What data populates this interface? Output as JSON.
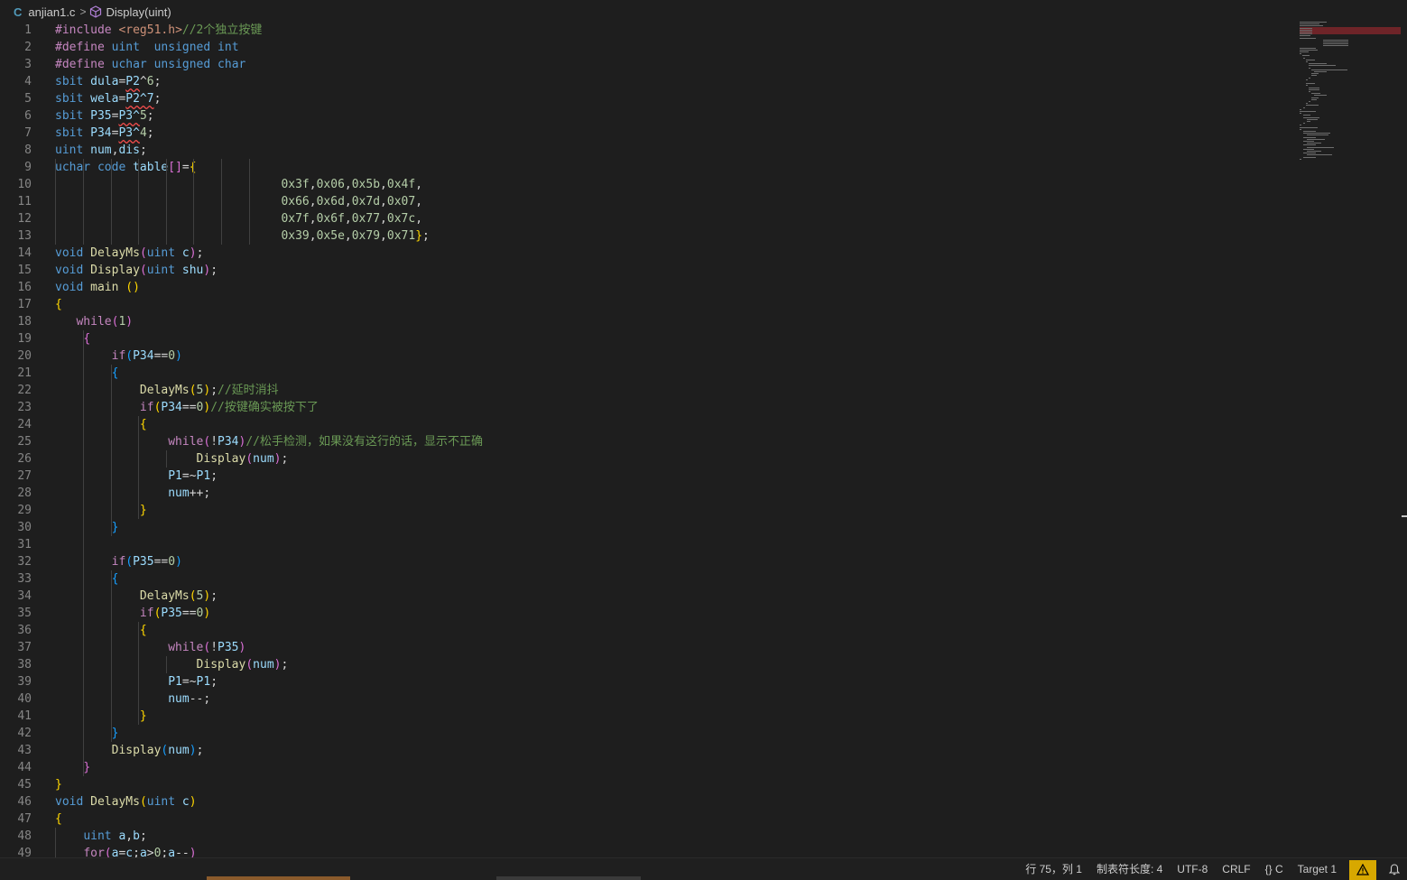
{
  "breadcrumb": {
    "file_icon_label": "C",
    "file": "anjian1.c",
    "separator": ">",
    "symbol": "Display(uint)",
    "symbol_icon": "cube-icon"
  },
  "code_lines": [
    {
      "n": "1",
      "html": "<span class=\"pp\">#include</span> <span class=\"str\">&lt;reg51.h&gt;</span><span class=\"cm\">//2个独立按键</span>"
    },
    {
      "n": "2",
      "html": "<span class=\"pp\">#define</span> <span class=\"kw\">uint</span>  <span class=\"kw\">unsigned</span> <span class=\"kw\">int</span>"
    },
    {
      "n": "3",
      "html": "<span class=\"pp\">#define</span> <span class=\"kw\">uchar</span> <span class=\"kw\">unsigned</span> <span class=\"kw\">char</span>"
    },
    {
      "n": "4",
      "html": "<span class=\"kw\">sbit</span> <span class=\"var\">dula</span>=<span class=\"var sq\">P2</span><span class=\"op\">^</span><span class=\"num\">6</span>;"
    },
    {
      "n": "5",
      "html": "<span class=\"kw\">sbit</span> <span class=\"var\">wela</span>=<span class=\"var sq\">P2^7</span>;"
    },
    {
      "n": "6",
      "html": "<span class=\"kw\">sbit</span> <span class=\"var\">P35</span>=<span class=\"var sq\">P3^</span><span class=\"num\">5</span>;"
    },
    {
      "n": "7",
      "html": "<span class=\"kw\">sbit</span> <span class=\"var\">P34</span>=<span class=\"var sq\">P3^</span><span class=\"num\">4</span>;"
    },
    {
      "n": "8",
      "html": "<span class=\"kw\">uint</span> <span class=\"var\">num</span>,<span class=\"var\">dis</span>;"
    },
    {
      "n": "9",
      "html": "<span class=\"kw\">uchar</span> <span class=\"kw\">code</span> <span class=\"var\">table</span><span class=\"b2\">[]</span>=<span class=\"b1\">{</span>"
    },
    {
      "n": "10",
      "html": "                                <span class=\"num\">0x3f</span>,<span class=\"num\">0x06</span>,<span class=\"num\">0x5b</span>,<span class=\"num\">0x4f</span>,"
    },
    {
      "n": "11",
      "html": "                                <span class=\"num\">0x66</span>,<span class=\"num\">0x6d</span>,<span class=\"num\">0x7d</span>,<span class=\"num\">0x07</span>,"
    },
    {
      "n": "12",
      "html": "                                <span class=\"num\">0x7f</span>,<span class=\"num\">0x6f</span>,<span class=\"num\">0x77</span>,<span class=\"num\">0x7c</span>,"
    },
    {
      "n": "13",
      "html": "                                <span class=\"num\">0x39</span>,<span class=\"num\">0x5e</span>,<span class=\"num\">0x79</span>,<span class=\"num\">0x71</span><span class=\"b1\">}</span>;"
    },
    {
      "n": "14",
      "html": "<span class=\"kw\">void</span> <span class=\"fn\">DelayMs</span><span class=\"b2\">(</span><span class=\"kw\">uint</span> <span class=\"var\">c</span><span class=\"b2\">)</span>;"
    },
    {
      "n": "15",
      "html": "<span class=\"kw\">void</span> <span class=\"fn\">Display</span><span class=\"b2\">(</span><span class=\"kw\">uint</span> <span class=\"var\">shu</span><span class=\"b2\">)</span>;"
    },
    {
      "n": "16",
      "html": "<span class=\"kw\">void</span> <span class=\"fn\">main</span> <span class=\"b1\">()</span>"
    },
    {
      "n": "17",
      "html": "<span class=\"b1\">{</span>"
    },
    {
      "n": "18",
      "html": "   <span class=\"ctrl\">while</span><span class=\"b2\">(</span><span class=\"num\">1</span><span class=\"b2\">)</span>"
    },
    {
      "n": "19",
      "html": "    <span class=\"b2\">{</span>"
    },
    {
      "n": "20",
      "html": "        <span class=\"ctrl\">if</span><span class=\"b3\">(</span><span class=\"var\">P34</span>==<span class=\"num\">0</span><span class=\"b3\">)</span>"
    },
    {
      "n": "21",
      "html": "        <span class=\"b3\">{</span>"
    },
    {
      "n": "22",
      "html": "            <span class=\"fn\">DelayMs</span><span class=\"b1\">(</span><span class=\"num\">5</span><span class=\"b1\">)</span>;<span class=\"cm\">//延时消抖</span>"
    },
    {
      "n": "23",
      "html": "            <span class=\"ctrl\">if</span><span class=\"b1\">(</span><span class=\"var\">P34</span>==<span class=\"num\">0</span><span class=\"b1\">)</span><span class=\"cm\">//按键确实被按下了</span>"
    },
    {
      "n": "24",
      "html": "            <span class=\"b1\">{</span>"
    },
    {
      "n": "25",
      "html": "                <span class=\"ctrl\">while</span><span class=\"b2\">(</span>!<span class=\"var\">P34</span><span class=\"b2\">)</span><span class=\"cm\">//松手检测，如果没有这行的话，显示不正确</span>"
    },
    {
      "n": "26",
      "html": "                    <span class=\"fn\">Display</span><span class=\"b2\">(</span><span class=\"var\">num</span><span class=\"b2\">)</span>;"
    },
    {
      "n": "27",
      "html": "                <span class=\"var\">P1</span>=~<span class=\"var\">P1</span>;"
    },
    {
      "n": "28",
      "html": "                <span class=\"var\">num</span>++;"
    },
    {
      "n": "29",
      "html": "            <span class=\"b1\">}</span>"
    },
    {
      "n": "30",
      "html": "        <span class=\"b3\">}</span>"
    },
    {
      "n": "31",
      "html": ""
    },
    {
      "n": "32",
      "html": "        <span class=\"ctrl\">if</span><span class=\"b3\">(</span><span class=\"var\">P35</span>==<span class=\"num\">0</span><span class=\"b3\">)</span>"
    },
    {
      "n": "33",
      "html": "        <span class=\"b3\">{</span>"
    },
    {
      "n": "34",
      "html": "            <span class=\"fn\">DelayMs</span><span class=\"b1\">(</span><span class=\"num\">5</span><span class=\"b1\">)</span>;"
    },
    {
      "n": "35",
      "html": "            <span class=\"ctrl\">if</span><span class=\"b1\">(</span><span class=\"var\">P35</span>==<span class=\"num\">0</span><span class=\"b1\">)</span>"
    },
    {
      "n": "36",
      "html": "            <span class=\"b1\">{</span>"
    },
    {
      "n": "37",
      "html": "                <span class=\"ctrl\">while</span><span class=\"b2\">(</span>!<span class=\"var\">P35</span><span class=\"b2\">)</span>"
    },
    {
      "n": "38",
      "html": "                    <span class=\"fn\">Display</span><span class=\"b2\">(</span><span class=\"var\">num</span><span class=\"b2\">)</span>;"
    },
    {
      "n": "39",
      "html": "                <span class=\"var\">P1</span>=~<span class=\"var\">P1</span>;"
    },
    {
      "n": "40",
      "html": "                <span class=\"var\">num</span>--;"
    },
    {
      "n": "41",
      "html": "            <span class=\"b1\">}</span>"
    },
    {
      "n": "42",
      "html": "        <span class=\"b3\">}</span>"
    },
    {
      "n": "43",
      "html": "        <span class=\"fn\">Display</span><span class=\"b3\">(</span><span class=\"var\">num</span><span class=\"b3\">)</span>;"
    },
    {
      "n": "44",
      "html": "    <span class=\"b2\">}</span>"
    },
    {
      "n": "45",
      "html": "<span class=\"b1\">}</span>"
    },
    {
      "n": "46",
      "html": "<span class=\"kw\">void</span> <span class=\"fn\">DelayMs</span><span class=\"b1\">(</span><span class=\"kw\">uint</span> <span class=\"var\">c</span><span class=\"b1\">)</span>"
    },
    {
      "n": "47",
      "html": "<span class=\"b1\">{</span>"
    },
    {
      "n": "48",
      "html": "    <span class=\"kw\">uint</span> <span class=\"var\">a</span>,<span class=\"var\">b</span>;"
    },
    {
      "n": "49",
      "html": "    <span class=\"ctrl\">for</span><span class=\"b2\">(</span><span class=\"var\">a</span>=<span class=\"var\">c</span>;<span class=\"var\">a</span>&gt;<span class=\"num\">0</span>;<span class=\"var\">a</span>--<span class=\"b2\">)</span>"
    }
  ],
  "status_bar": {
    "position": "行 75，列 1",
    "tab_size": "制表符长度: 4",
    "encoding": "UTF-8",
    "line_ending": "CRLF",
    "language": "{} C",
    "target": "Target 1",
    "warning_icon": "warning-icon",
    "bell_icon": "bell-icon"
  },
  "theme": {
    "background": "#1e1e1e",
    "warning_bg": "#d7a800",
    "error_underline": "#f14c4c"
  }
}
